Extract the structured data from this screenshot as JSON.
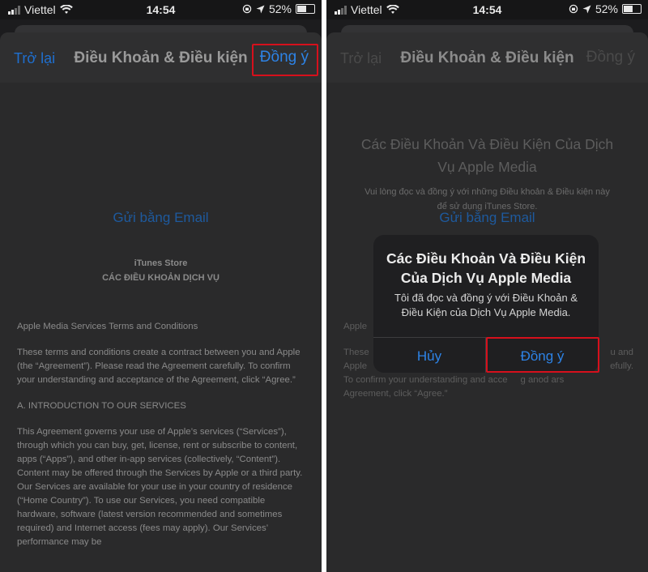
{
  "status_bar": {
    "carrier": "Viettel",
    "time": "14:54",
    "battery": "52%"
  },
  "nav": {
    "back": "Trở lại",
    "title": "Điều Khoản & Điều kiện",
    "agree": "Đồng ý"
  },
  "content": {
    "email_link": "Gửi bằng Email",
    "store_name": "iTunes Store",
    "store_terms": "CÁC ĐIỀU KHOẢN DỊCH VỤ",
    "doc_title": "Các Điều Khoản Và Điều Kiện Của Dịch Vụ Apple Media",
    "doc_subtitle": "Vui lòng đọc và đồng ý với những Điều khoản & Điều kiện này để sử dụng iTunes Store.",
    "paragraphs": [
      "Apple Media Services Terms and Conditions",
      "These terms and conditions create a contract between you and Apple (the “Agreement”). Please read the Agreement carefully. To confirm your understanding and acceptance of the Agreement, click “Agree.”",
      "A. INTRODUCTION TO OUR SERVICES",
      "This Agreement governs your use of Apple’s services (“Services”), through which you can buy, get, license, rent or subscribe to content, apps (“Apps”), and other in-app services (collectively, “Content”). Content may be offered through the Services by Apple or a third party. Our Services are available for your use in your country of residence (“Home Country”). To use our Services, you need compatible hardware, software (latest version recommended and sometimes required) and Internet access (fees may apply). Our Services’ performance may be"
    ],
    "right_fragments": {
      "p0": "Apple",
      "p1_l1": "These",
      "p1_l1_end": "u and",
      "p1_l2": "Apple",
      "p1_l2_end": "efully.",
      "p1_l3": "To confirm your understanding and acce     g anod ars",
      "p1_l4": "Agreement, click “Agree.”"
    }
  },
  "alert": {
    "title": "Các Điều Khoản Và Điều Kiện Của Dịch Vụ Apple Media",
    "message": "Tôi đã đọc và đồng ý với Điều Khoản & Điều Kiện của Dịch Vụ Apple Media.",
    "cancel": "Hủy",
    "agree": "Đồng ý"
  },
  "colors": {
    "link_blue": "#2d83e6",
    "highlight_red": "#d6101c"
  }
}
